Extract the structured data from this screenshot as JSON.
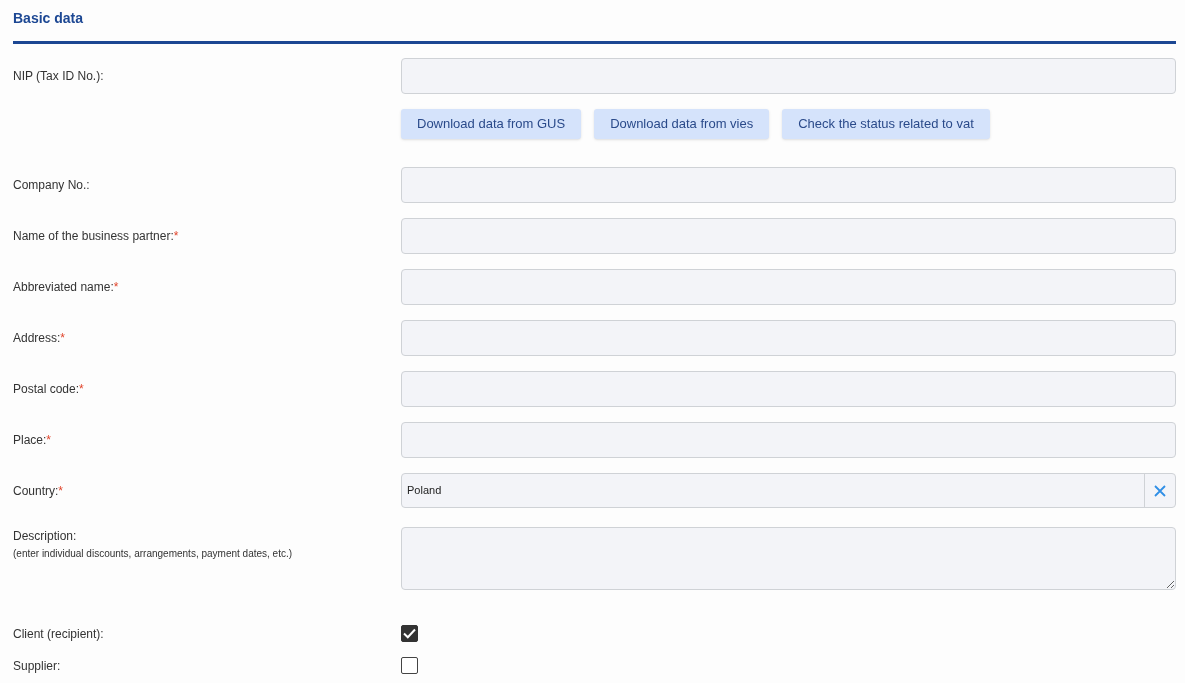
{
  "section": {
    "title": "Basic data"
  },
  "fields": [
    {
      "kind": "text",
      "label": "NIP (Tax ID No.):",
      "buttons": [
        "Download data from GUS",
        "Download data from vies",
        "Check the status related to vat"
      ]
    },
    {
      "kind": "text",
      "label": "Company No.:"
    },
    {
      "kind": "text",
      "label": "Name of the business partner:",
      "mark": "*"
    },
    {
      "kind": "text",
      "label": "Abbreviated name:",
      "mark": "*"
    },
    {
      "kind": "text",
      "label": "Address:",
      "mark": "*"
    },
    {
      "kind": "text",
      "label": "Postal code:",
      "mark": "*"
    },
    {
      "kind": "text",
      "label": "Place:",
      "mark": "*"
    },
    {
      "kind": "select",
      "label": "Country:",
      "mark": "*",
      "value": "Poland"
    },
    {
      "kind": "textarea",
      "label": "Description:",
      "hint": "(enter individual discounts, arrangements, payment dates, etc.)"
    },
    {
      "kind": "checkbox",
      "label": "Client (recipient):",
      "checked": true
    },
    {
      "kind": "checkbox",
      "label": "Supplier:",
      "checked": false
    }
  ]
}
